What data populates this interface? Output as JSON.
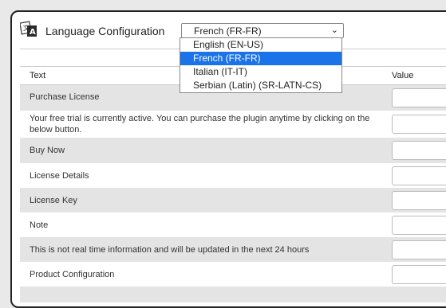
{
  "header": {
    "title": "Language Configuration",
    "language_select": {
      "selected": "French (FR-FR)"
    }
  },
  "dropdown": {
    "options": [
      "English (EN-US)",
      "French (FR-FR)",
      "Italian (IT-IT)",
      "Serbian (Latin) (SR-LATN-CS)"
    ],
    "selected_index": 1
  },
  "table": {
    "headers": {
      "text": "Text",
      "value": "Value"
    },
    "rows": [
      {
        "text": "Purchase License",
        "value": ""
      },
      {
        "text": "Your free trial is currently active. You can purchase the plugin anytime by clicking on the below button.",
        "value": ""
      },
      {
        "text": "Buy Now",
        "value": ""
      },
      {
        "text": "License Details",
        "value": ""
      },
      {
        "text": "License Key",
        "value": ""
      },
      {
        "text": "Note",
        "value": ""
      },
      {
        "text": "This is not real time information and will be updated in the next 24 hours",
        "value": ""
      },
      {
        "text": "Product Configuration",
        "value": ""
      }
    ]
  },
  "colors": {
    "selected_option": "#1a73e8",
    "row_alt": "#e4e4e4"
  },
  "icons": {
    "logo": "translate-icon",
    "select_arrow": "chevron-down-icon"
  }
}
